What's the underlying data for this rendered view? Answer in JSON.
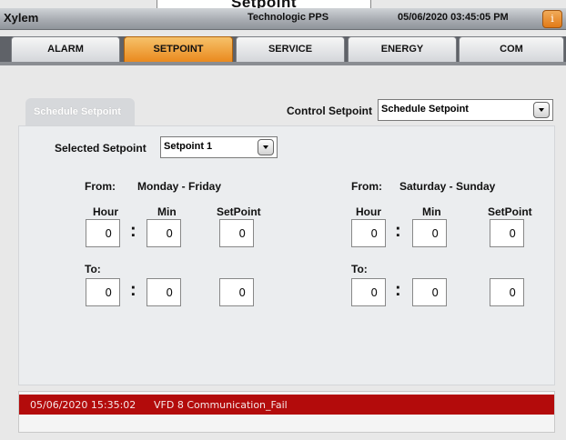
{
  "header": {
    "banner": "Setpoint",
    "app_title": "Xylem",
    "subtitle": "Technologic PPS",
    "datetime": "05/06/2020 03:45:05 PM",
    "info_icon": "info-icon",
    "accent_color": "#ea8a1e"
  },
  "tabs": [
    {
      "label": "ALARM",
      "active": false
    },
    {
      "label": "SETPOINT",
      "active": true
    },
    {
      "label": "SERVICE",
      "active": false
    },
    {
      "label": "ENERGY",
      "active": false
    },
    {
      "label": "COM",
      "active": false
    }
  ],
  "panel": {
    "tab_label": "Schedule Setpoint",
    "control_setpoint_label": "Control Setpoint",
    "control_setpoint_value": "Schedule Setpoint",
    "selected_setpoint_label": "Selected Setpoint",
    "selected_setpoint_value": "Setpoint 1"
  },
  "weekday": {
    "from_label": "From:",
    "range": "Monday - Friday",
    "hour_label": "Hour",
    "min_label": "Min",
    "setpoint_label": "SetPoint",
    "from_hour": "0",
    "from_min": "0",
    "from_setpoint": "0",
    "to_label": "To:",
    "to_hour": "0",
    "to_min": "0",
    "to_setpoint": "0"
  },
  "weekend": {
    "from_label": "From:",
    "range": "Saturday - Sunday",
    "hour_label": "Hour",
    "min_label": "Min",
    "setpoint_label": "SetPoint",
    "from_hour": "0",
    "from_min": "0",
    "from_setpoint": "0",
    "to_label": "To:",
    "to_hour": "0",
    "to_min": "0",
    "to_setpoint": "0"
  },
  "colon": ":",
  "alarm": {
    "timestamp": "05/06/2020 15:35:02",
    "message": "VFD 8 Communication_Fail",
    "color": "#b30b0b"
  }
}
